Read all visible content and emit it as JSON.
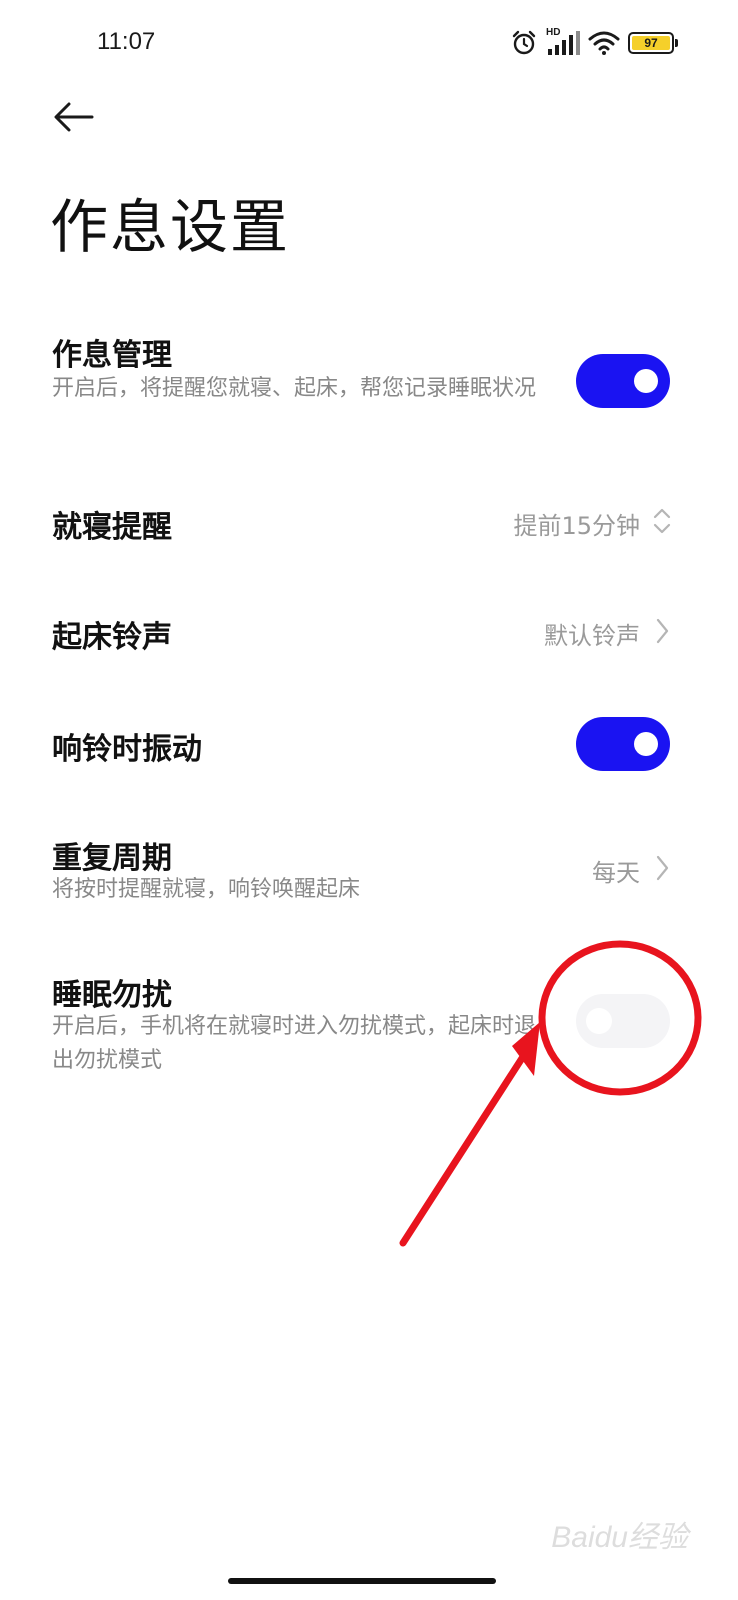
{
  "status_bar": {
    "time": "11:07",
    "icons": [
      "alarm-icon",
      "hd-signal-icon",
      "wifi-icon",
      "battery-icon"
    ],
    "network_label": "HD",
    "battery_level": "97"
  },
  "header": {
    "back_icon": "back-arrow-icon",
    "title": "作息设置"
  },
  "settings": {
    "routine_management": {
      "title": "作息管理",
      "subtitle": "开启后，将提醒您就寝、起床，帮您记录睡眠状况",
      "enabled": true
    },
    "bedtime_reminder": {
      "title": "就寝提醒",
      "value": "提前15分钟"
    },
    "wake_ringtone": {
      "title": "起床铃声",
      "value": "默认铃声"
    },
    "vibrate_on_ring": {
      "title": "响铃时振动",
      "enabled": true
    },
    "repeat_cycle": {
      "title": "重复周期",
      "subtitle": "将按时提醒就寝，响铃唤醒起床",
      "value": "每天"
    },
    "sleep_dnd": {
      "title": "睡眠勿扰",
      "subtitle": "开启后，手机将在就寝时进入勿扰模式，起床时退出勿扰模式",
      "enabled": false
    }
  },
  "colors": {
    "toggle_on": "#1a13f2",
    "annotation": "#e8141e"
  },
  "watermark": "Baidu经验"
}
